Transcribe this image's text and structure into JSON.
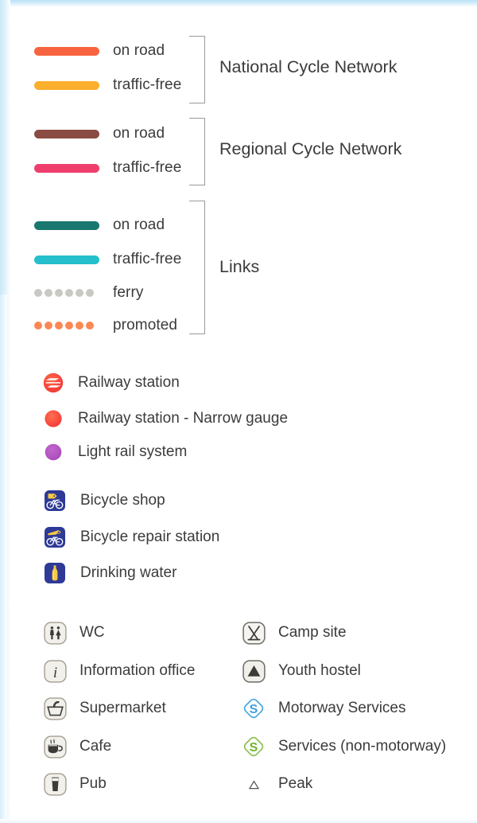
{
  "legend": {
    "line_groups": [
      {
        "title": "National Cycle Network",
        "entries": [
          {
            "label": "on road",
            "style": "solid",
            "color": "#f8633f"
          },
          {
            "label": "traffic-free",
            "style": "solid",
            "color": "#fbaf2d"
          }
        ]
      },
      {
        "title": "Regional Cycle Network",
        "entries": [
          {
            "label": "on road",
            "style": "solid",
            "color": "#8a4b42"
          },
          {
            "label": "traffic-free",
            "style": "solid",
            "color": "#ef3e6e"
          }
        ]
      },
      {
        "title": "Links",
        "entries": [
          {
            "label": "on road",
            "style": "solid",
            "color": "#18786f"
          },
          {
            "label": "traffic-free",
            "style": "solid",
            "color": "#24bfcb"
          },
          {
            "label": "ferry",
            "style": "dotted",
            "color": "#c9c9c3"
          },
          {
            "label": "promoted",
            "style": "dotted",
            "color": "#f98855"
          }
        ]
      }
    ],
    "transport": [
      {
        "label": "Railway station",
        "icon": "railway-station-icon",
        "color": "#f44336"
      },
      {
        "label": "Railway station - Narrow gauge",
        "icon": "narrow-gauge-station-icon",
        "color": "#f9483f"
      },
      {
        "label": "Light rail system",
        "icon": "light-rail-icon",
        "color": "#b356c0"
      }
    ],
    "cycle_services": [
      {
        "label": "Bicycle shop",
        "icon": "bicycle-shop-icon",
        "color": "#2e3a96"
      },
      {
        "label": "Bicycle repair station",
        "icon": "bicycle-repair-icon",
        "color": "#2e3a96"
      },
      {
        "label": "Drinking water",
        "icon": "drinking-water-icon",
        "color": "#2e3a96"
      }
    ],
    "amenities_left": [
      {
        "label": "WC",
        "icon": "wc-icon"
      },
      {
        "label": "Information office",
        "icon": "information-icon"
      },
      {
        "label": "Supermarket",
        "icon": "supermarket-icon"
      },
      {
        "label": "Cafe",
        "icon": "cafe-icon"
      },
      {
        "label": "Pub",
        "icon": "pub-icon"
      }
    ],
    "amenities_right": [
      {
        "label": "Camp site",
        "icon": "camp-site-icon"
      },
      {
        "label": "Youth hostel",
        "icon": "youth-hostel-icon"
      },
      {
        "label": "Motorway Services",
        "icon": "motorway-services-icon",
        "color": "#4aa8e0"
      },
      {
        "label": "Services (non-motorway)",
        "icon": "services-icon",
        "color": "#7cb93f"
      },
      {
        "label": "Peak",
        "icon": "peak-icon"
      }
    ]
  }
}
